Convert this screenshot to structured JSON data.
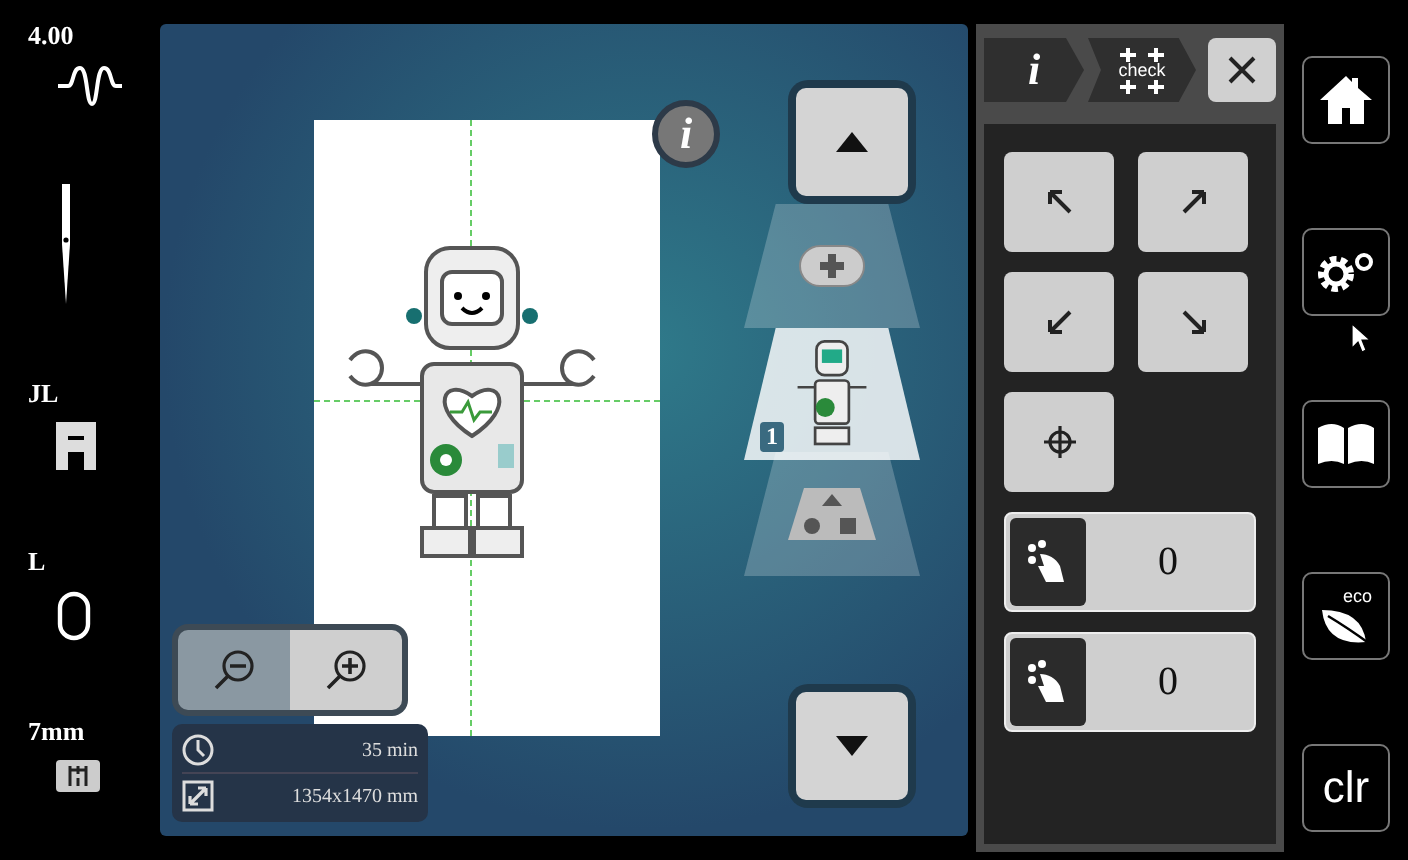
{
  "left_bar": [
    {
      "label": "4.00",
      "kind": "tension"
    },
    {
      "kind": "needle"
    },
    {
      "label": "JL",
      "kind": "foot"
    },
    {
      "label": "L",
      "kind": "hoop"
    },
    {
      "label": "7mm",
      "kind": "plate"
    }
  ],
  "info_button": {
    "label": "i"
  },
  "layers": [
    {
      "kind": "add",
      "selected": false
    },
    {
      "kind": "design",
      "selected": true,
      "number": "1"
    },
    {
      "kind": "shapes",
      "selected": false
    }
  ],
  "design_info": {
    "time": "35 min",
    "size": "1354x1470 mm"
  },
  "panel": {
    "tabs": [
      {
        "kind": "info",
        "label": "i"
      },
      {
        "kind": "check",
        "label": "check"
      }
    ],
    "moves": [
      {
        "kind": "nw"
      },
      {
        "kind": "ne"
      },
      {
        "kind": "sw"
      },
      {
        "kind": "se"
      }
    ],
    "fields": [
      {
        "value": "0"
      },
      {
        "value": "0"
      }
    ]
  },
  "right_bar": [
    {
      "kind": "home"
    },
    {
      "kind": "settings"
    },
    {
      "kind": "book"
    },
    {
      "kind": "eco",
      "label": "eco"
    },
    {
      "kind": "clr",
      "label": "clr"
    }
  ]
}
